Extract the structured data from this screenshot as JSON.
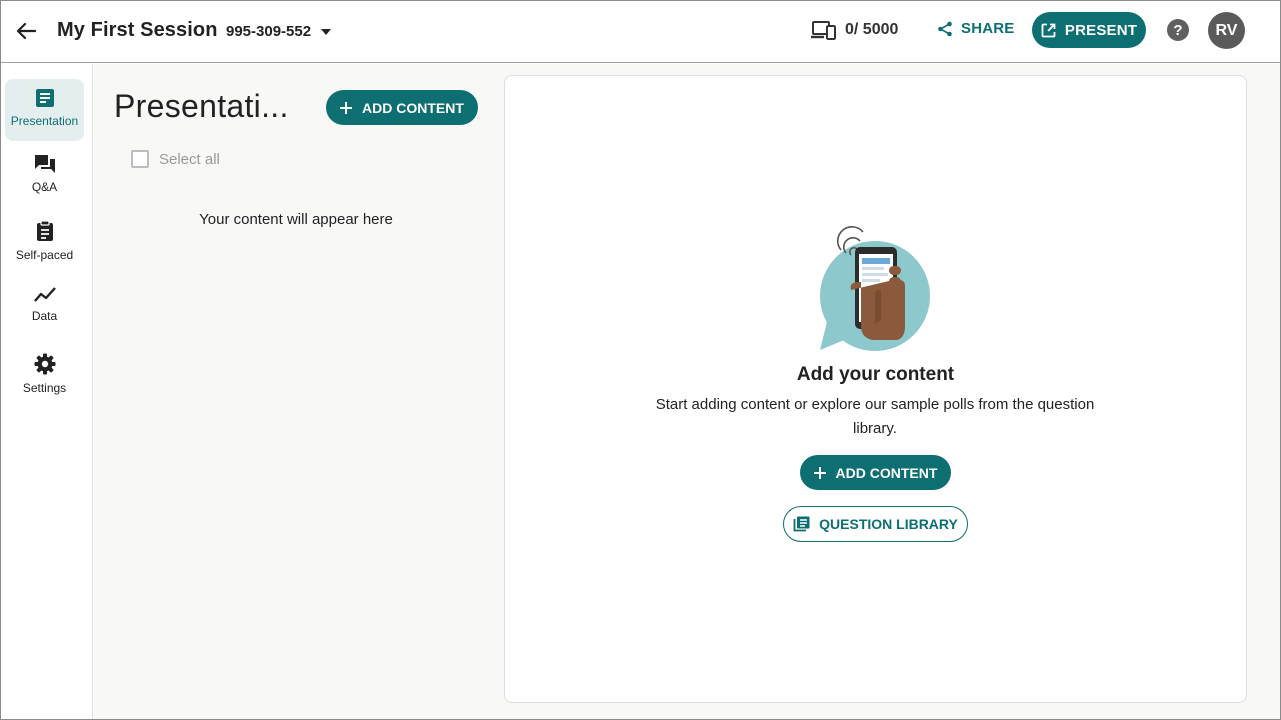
{
  "header": {
    "session_title": "My First Session",
    "session_code": "995-309-552",
    "participants": "0/ 5000",
    "share_label": "SHARE",
    "present_label": "PRESENT",
    "help_label": "?",
    "avatar_initials": "RV"
  },
  "sidebar": {
    "items": [
      {
        "label": "Presentation",
        "icon": "presentation-doc-icon",
        "active": true
      },
      {
        "label": "Q&A",
        "icon": "chat-bubbles-icon"
      },
      {
        "label": "Self-paced",
        "icon": "clipboard-icon"
      },
      {
        "label": "Data",
        "icon": "trend-line-icon"
      },
      {
        "label": "Settings",
        "icon": "gear-icon"
      }
    ]
  },
  "list_panel": {
    "title": "Presentati...",
    "add_content_label": "ADD CONTENT",
    "select_all_label": "Select all",
    "empty_message": "Your content will appear here"
  },
  "main": {
    "title": "Add your content",
    "description": "Start adding content or explore our sample polls from the question library.",
    "add_content_label": "ADD CONTENT",
    "question_library_label": "QUESTION LIBRARY"
  },
  "colors": {
    "brand": "#0e6f73",
    "active_nav_bg": "#e4eeee",
    "panel_bg": "#f8f8f7"
  }
}
